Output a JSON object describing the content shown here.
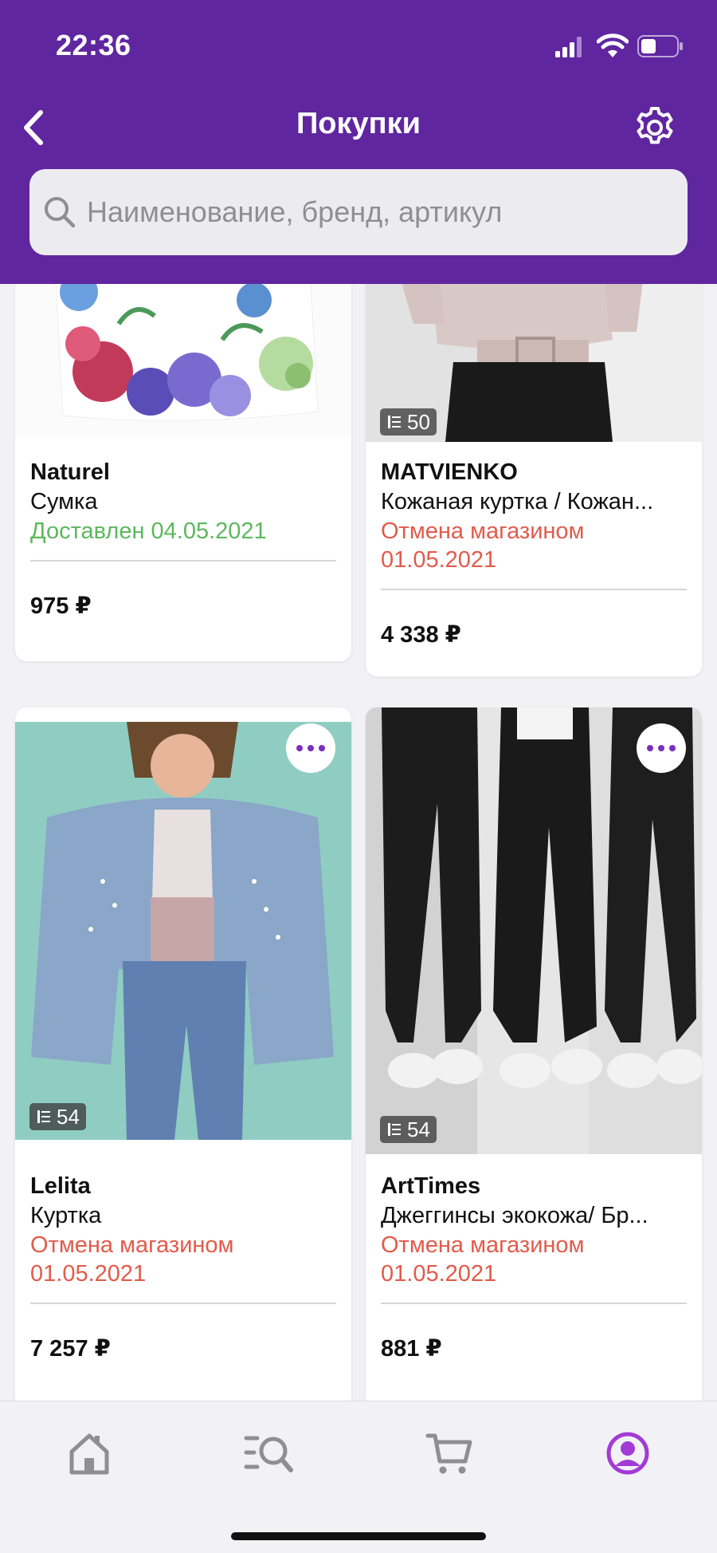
{
  "status_bar": {
    "time": "22:36"
  },
  "nav": {
    "title": "Покупки",
    "back_icon": "chevron-left-icon",
    "settings_icon": "gear-icon"
  },
  "search": {
    "placeholder": "Наименование, бренд, артикул"
  },
  "colors": {
    "header": "#5f26a0",
    "accent": "#7b2fbf",
    "delivered": "#5cb85c",
    "cancelled": "#e25b4b"
  },
  "items": [
    {
      "brand": "Naturel",
      "name": "Сумка",
      "status": "Доставлен 04.05.2021",
      "price": "975 ₽"
    },
    {
      "brand": "MATVIENKO",
      "name": "Кожаная куртка / Кожан...",
      "status_line1": "Отмена магазином",
      "status_line2": "01.05.2021",
      "price": "4 338 ₽",
      "photos": "50"
    },
    {
      "brand": "Lelita",
      "name": "Куртка",
      "status_line1": "Отмена магазином",
      "status_line2": "01.05.2021",
      "price": "7 257 ₽",
      "photos": "54"
    },
    {
      "brand": "ArtTimes",
      "name": "Джеггинсы экокожа/ Бр...",
      "status_line1": "Отмена магазином",
      "status_line2": "01.05.2021",
      "price": "881 ₽",
      "photos": "54"
    }
  ],
  "tabs": [
    {
      "icon": "home-icon"
    },
    {
      "icon": "catalog-search-icon"
    },
    {
      "icon": "cart-icon"
    },
    {
      "icon": "profile-icon",
      "active": true
    }
  ]
}
